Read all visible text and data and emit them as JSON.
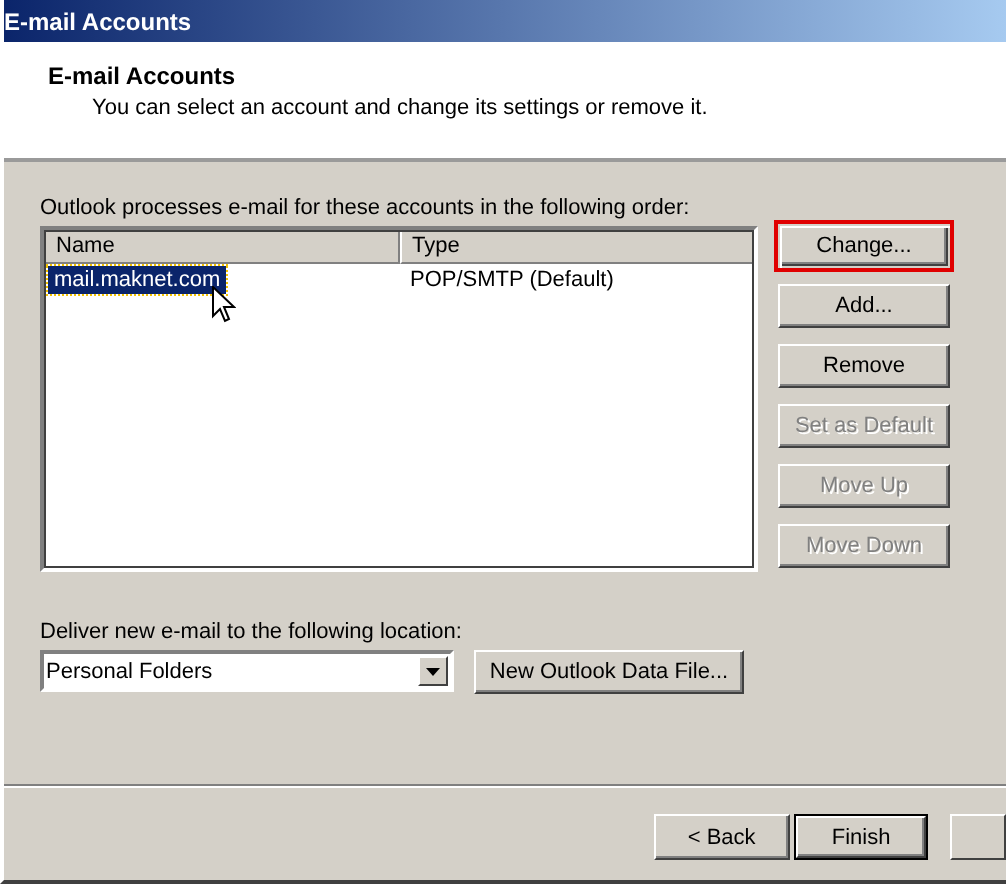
{
  "window": {
    "title": "E-mail Accounts"
  },
  "header": {
    "title": "E-mail Accounts",
    "subtitle": "You can select an account and change its settings or remove it."
  },
  "accounts": {
    "label": "Outlook processes e-mail for these accounts in the following order:",
    "columns": [
      "Name",
      "Type"
    ],
    "rows": [
      {
        "name": "mail.maknet.com",
        "type": "POP/SMTP (Default)",
        "selected": true
      }
    ]
  },
  "side_buttons": [
    {
      "label": "Change...",
      "disabled": false,
      "highlighted": true
    },
    {
      "label": "Add...",
      "disabled": false,
      "highlighted": false
    },
    {
      "label": "Remove",
      "disabled": false,
      "highlighted": false
    },
    {
      "label": "Set as Default",
      "disabled": true,
      "highlighted": false
    },
    {
      "label": "Move Up",
      "disabled": true,
      "highlighted": false
    },
    {
      "label": "Move Down",
      "disabled": true,
      "highlighted": false
    }
  ],
  "delivery": {
    "label": "Deliver new e-mail to the following location:",
    "value": "Personal Folders",
    "button": "New Outlook Data File..."
  },
  "footer_buttons": [
    {
      "label": "< Back",
      "default": false
    },
    {
      "label": "Finish",
      "default": true
    }
  ]
}
